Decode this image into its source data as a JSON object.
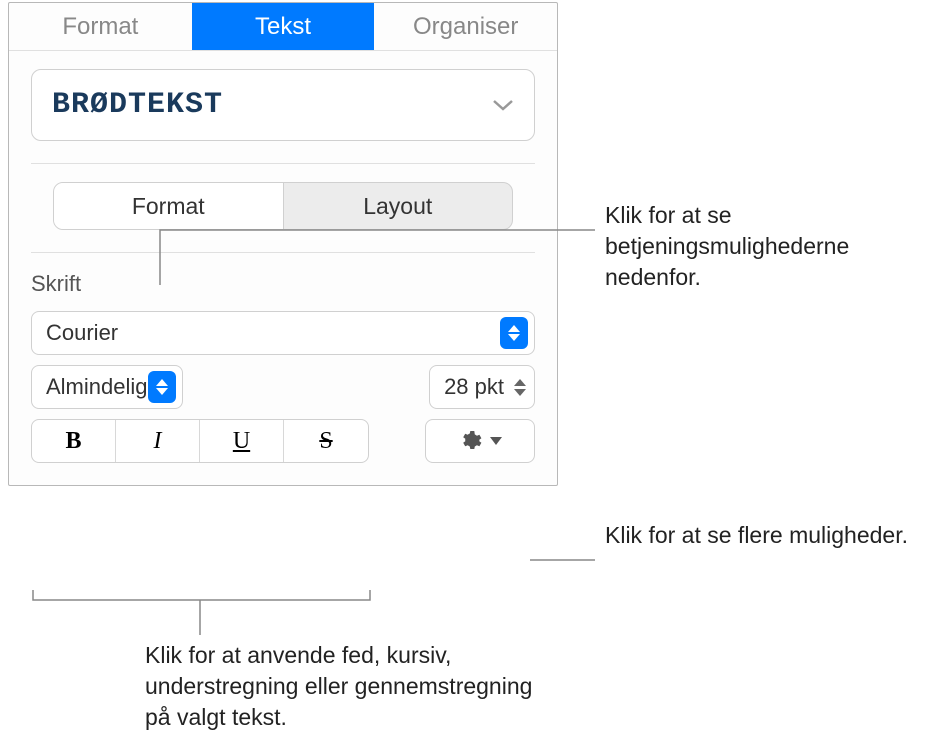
{
  "tabs": {
    "format": "Format",
    "text": "Tekst",
    "organize": "Organiser"
  },
  "paragraphStyle": {
    "label": "BRØDTEKST"
  },
  "subTabs": {
    "format": "Format",
    "layout": "Layout"
  },
  "fontSection": {
    "heading": "Skrift",
    "family": "Courier",
    "typeface": "Almindelig",
    "size": "28 pkt"
  },
  "styleButtons": {
    "bold": "B",
    "italic": "I",
    "underline": "U",
    "strike": "S"
  },
  "callouts": {
    "c1": "Klik for at se betjeningsmulighederne nedenfor.",
    "c2": "Klik for at se flere muligheder.",
    "c3": "Klik for at anvende fed, kursiv, understregning eller gennemstregning på valgt tekst."
  }
}
